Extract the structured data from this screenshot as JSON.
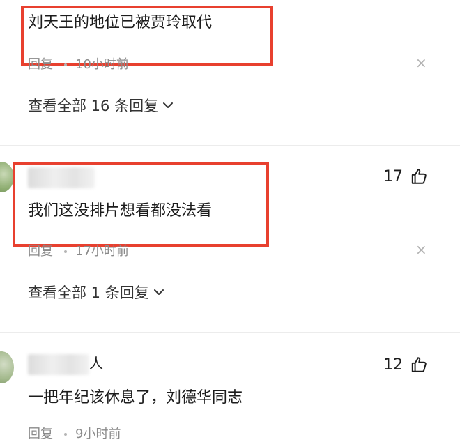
{
  "comments": [
    {
      "text": "刘天王的地位已被贾玲取代",
      "reply_label": "回复",
      "time": "10小时前",
      "view_replies": "查看全部 16 条回复",
      "close_glyph": "×"
    },
    {
      "likes": "17",
      "text": "我们这没排片想看都没法看",
      "reply_label": "回复",
      "time": "17小时前",
      "view_replies": "查看全部 1 条回复",
      "close_glyph": "×"
    },
    {
      "username_suffix": "人",
      "likes": "12",
      "text": "一把年纪该休息了，刘德华同志",
      "reply_label": "回复",
      "time": "9小时前"
    }
  ],
  "colors": {
    "highlight_box": "#e8402f",
    "meta_text": "#8a8a8a",
    "avatar_green": "#9bbf7a"
  },
  "icons": {
    "like": "thumbs-up-icon",
    "expand": "chevron-down-icon",
    "dismiss": "close-icon"
  }
}
